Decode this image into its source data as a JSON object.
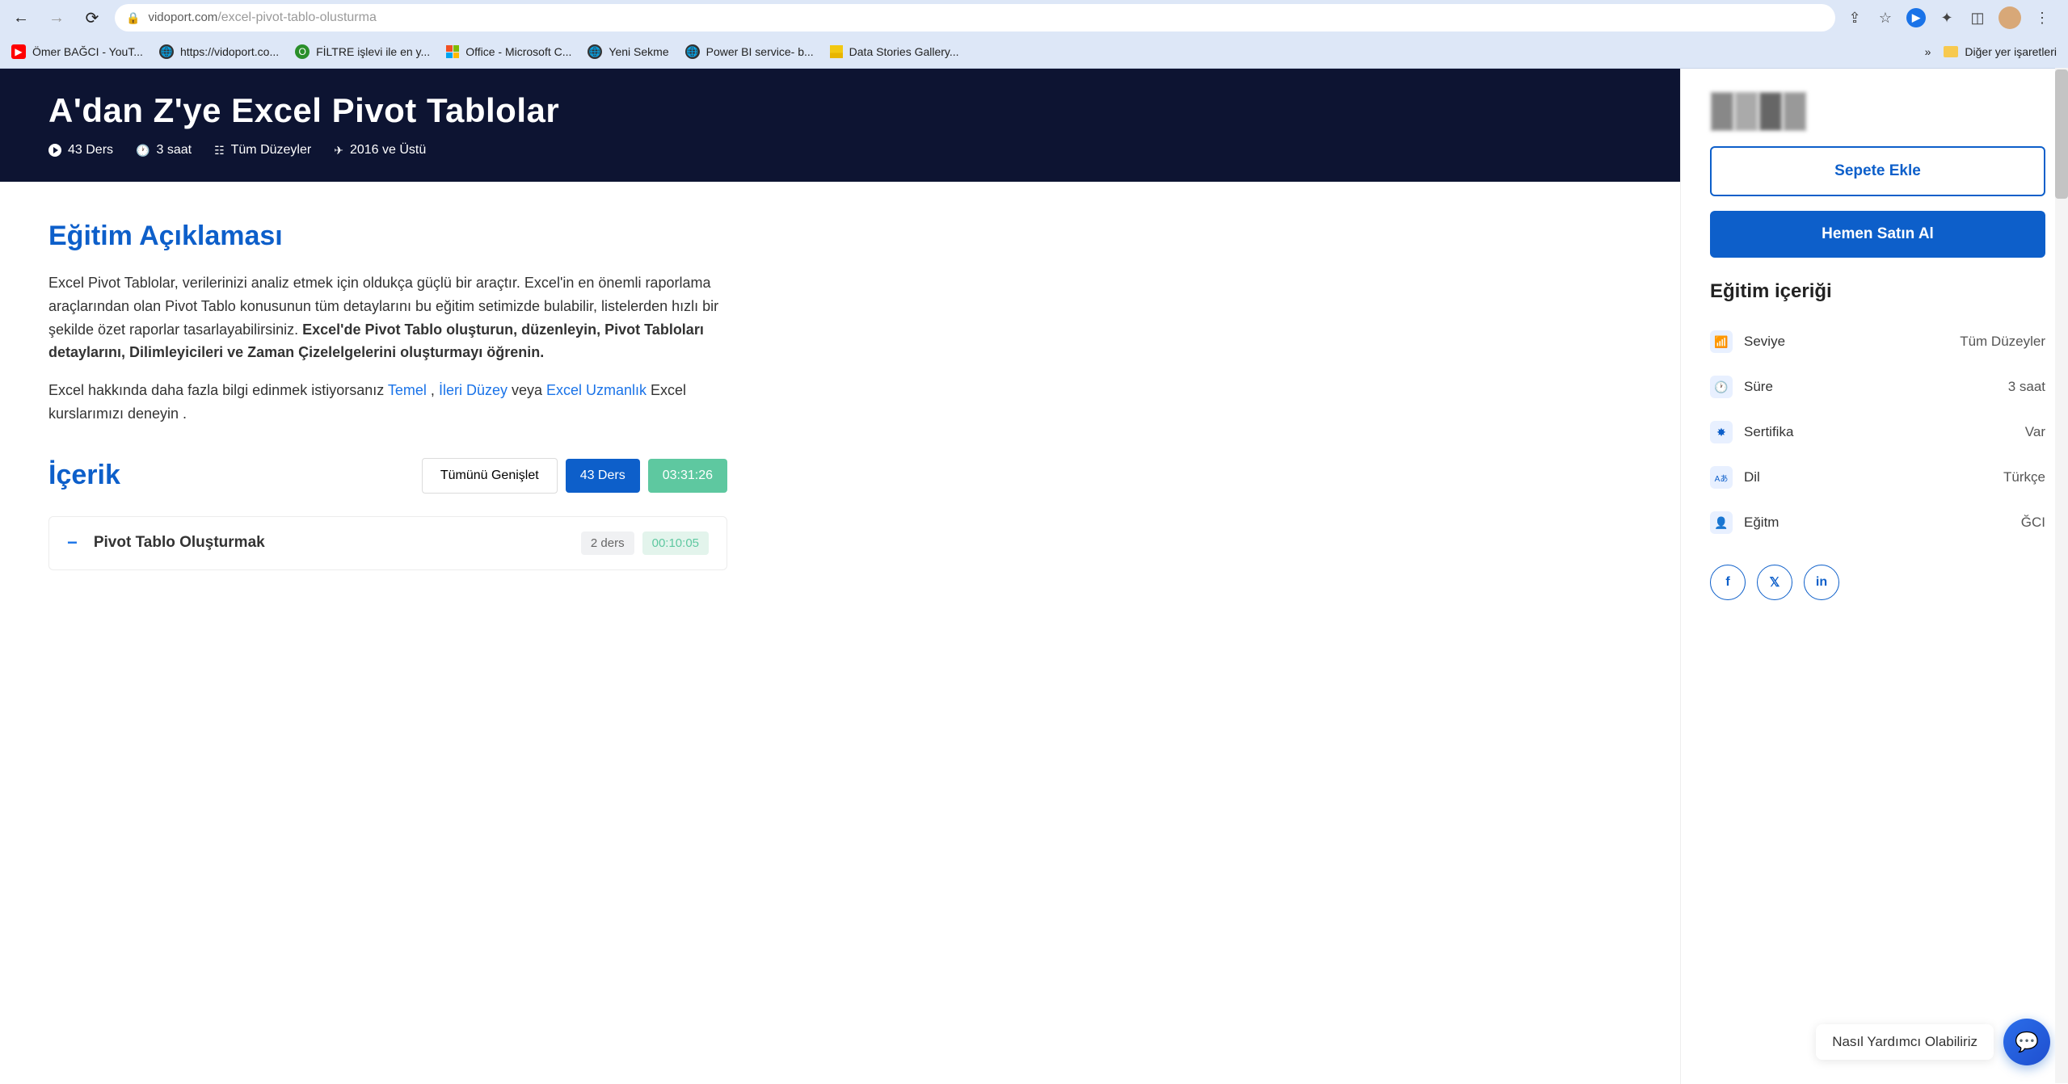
{
  "browser": {
    "url_host": "vidoport.com",
    "url_path": "/excel-pivot-tablo-olusturma",
    "bookmarks": [
      {
        "label": "Ömer BAĞCI - YouT...",
        "icon": "yt"
      },
      {
        "label": "https://vidoport.co...",
        "icon": "globe"
      },
      {
        "label": "FİLTRE işlevi ile en y...",
        "icon": "green"
      },
      {
        "label": "Office - Microsoft C...",
        "icon": "ms"
      },
      {
        "label": "Yeni Sekme",
        "icon": "globe"
      },
      {
        "label": "Power BI service- b...",
        "icon": "globe"
      },
      {
        "label": "Data Stories Gallery...",
        "icon": "pbi"
      }
    ],
    "overflow": "»",
    "other_bookmarks": "Diğer yer işaretleri"
  },
  "hero": {
    "title": "A'dan Z'ye Excel Pivot Tablolar",
    "meta": {
      "lessons": "43 Ders",
      "duration": "3 saat",
      "level": "Tüm Düzeyler",
      "version": "2016 ve Üstü"
    }
  },
  "desc": {
    "heading": "Eğitim Açıklaması",
    "p1_a": "Excel Pivot Tablolar, verilerinizi analiz etmek için oldukça güçlü bir araçtır. Excel'in en önemli raporlama araçlarından olan Pivot Tablo konusunun tüm detaylarını bu eğitim setimizde bulabilir, listelerden hızlı bir şekilde özet raporlar tasarlayabilirsiniz. ",
    "p1_b": "Excel'de Pivot Tablo oluşturun, düzenleyin, Pivot Tabloları detaylarını, Dilimleyicileri ve Zaman Çizelelgelerini oluşturmayı öğrenin.",
    "p2_a": "Excel hakkında daha fazla bilgi edinmek istiyorsanız ",
    "p2_l1": "Temel",
    "p2_s1": " , ",
    "p2_l2": "İleri Düzey",
    "p2_s2": " veya ",
    "p2_l3": "Excel Uzmanlık",
    "p2_b": " Excel kurslarımızı deneyin ."
  },
  "icerik": {
    "heading": "İçerik",
    "expand": "Tümünü Genişlet",
    "count": "43 Ders",
    "total_time": "03:31:26",
    "section1": {
      "title": "Pivot Tablo Oluşturmak",
      "count": "2 ders",
      "time": "00:10:05"
    }
  },
  "sidebar": {
    "add_cart": "Sepete Ekle",
    "buy_now": "Hemen Satın Al",
    "content_heading": "Eğitim içeriği",
    "rows": [
      {
        "icon": "📶",
        "label": "Seviye",
        "value": "Tüm Düzeyler"
      },
      {
        "icon": "🕐",
        "label": "Süre",
        "value": "3 saat"
      },
      {
        "icon": "✸",
        "label": "Sertifika",
        "value": "Var"
      },
      {
        "icon": "Aあ",
        "label": "Dil",
        "value": "Türkçe"
      },
      {
        "icon": "👤",
        "label": "Eğitm",
        "value": "ĞCI"
      }
    ]
  },
  "chat": {
    "text": "Nasıl Yardımcı Olabiliriz"
  }
}
